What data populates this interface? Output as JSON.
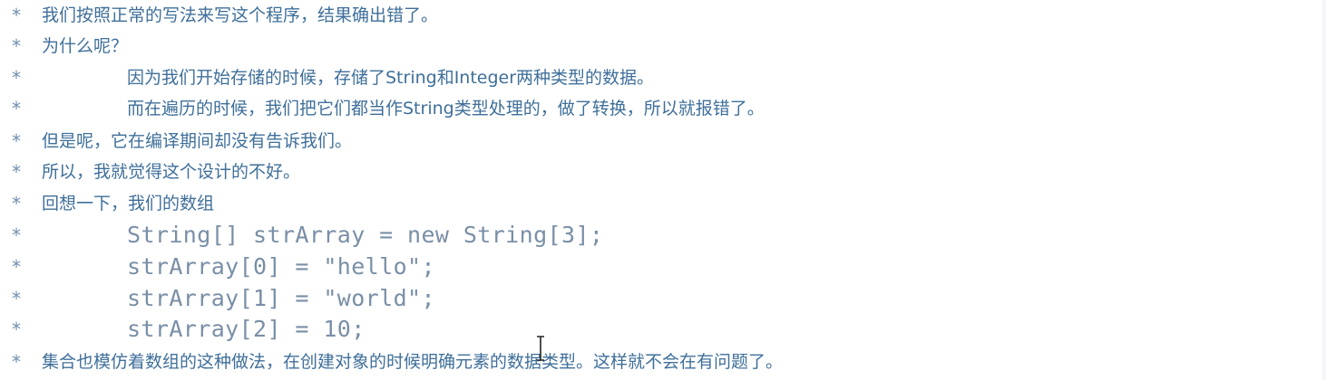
{
  "editor": {
    "lines": [
      {
        "star": "*",
        "text": "我们按照正常的写法来写这个程序，结果确出错了。"
      },
      {
        "star": "*",
        "text": "为什么呢？"
      },
      {
        "star": "*",
        "text": "因为我们开始存储的时候，存储了String和Integer两种类型的数据。"
      },
      {
        "star": "*",
        "text": "而在遍历的时候，我们把它们都当作String类型处理的，做了转换，所以就报错了。"
      },
      {
        "star": "*",
        "text": "但是呢，它在编译期间却没有告诉我们。"
      },
      {
        "star": "*",
        "text": "所以，我就觉得这个设计的不好。"
      },
      {
        "star": "*",
        "text": "回想一下，我们的数组"
      },
      {
        "star": "*",
        "text": "String[] strArray = new String[3];"
      },
      {
        "star": "*",
        "text": "strArray[0] = \"hello\";"
      },
      {
        "star": "*",
        "text": "strArray[1] = \"world\";"
      },
      {
        "star": "*",
        "text": "strArray[2] = 10;"
      },
      {
        "star": "*",
        "text": "集合也模仿着数组的这种做法，在创建对象的时候明确元素的数据类型。这样就不会在有问题了。"
      }
    ]
  },
  "cursor": {
    "icon": "text-cursor-icon"
  },
  "colors": {
    "text": "#3f6f9a",
    "code": "#7a8fa6",
    "star": "#6f8fb0",
    "background": "#ffffff"
  }
}
